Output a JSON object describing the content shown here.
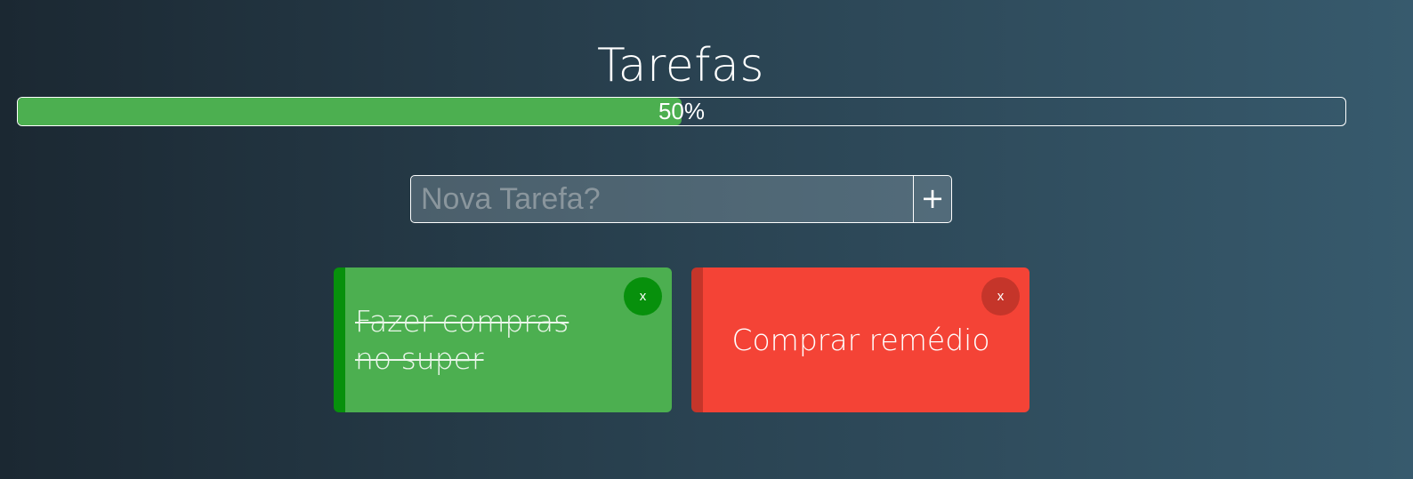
{
  "header": {
    "title": "Tarefas"
  },
  "progress": {
    "percent": 50,
    "label": "50%",
    "fill_color": "#4caf50"
  },
  "new_task": {
    "placeholder": "Nova Tarefa?",
    "value": "",
    "add_label": "+"
  },
  "tasks": [
    {
      "text": "Fazer compras no super",
      "done": true,
      "delete_label": "x",
      "color": "#4caf50",
      "accent_color": "#07900c"
    },
    {
      "text": "Comprar remédio",
      "done": false,
      "delete_label": "x",
      "color": "#f44336",
      "accent_color": "#c5352a"
    }
  ]
}
